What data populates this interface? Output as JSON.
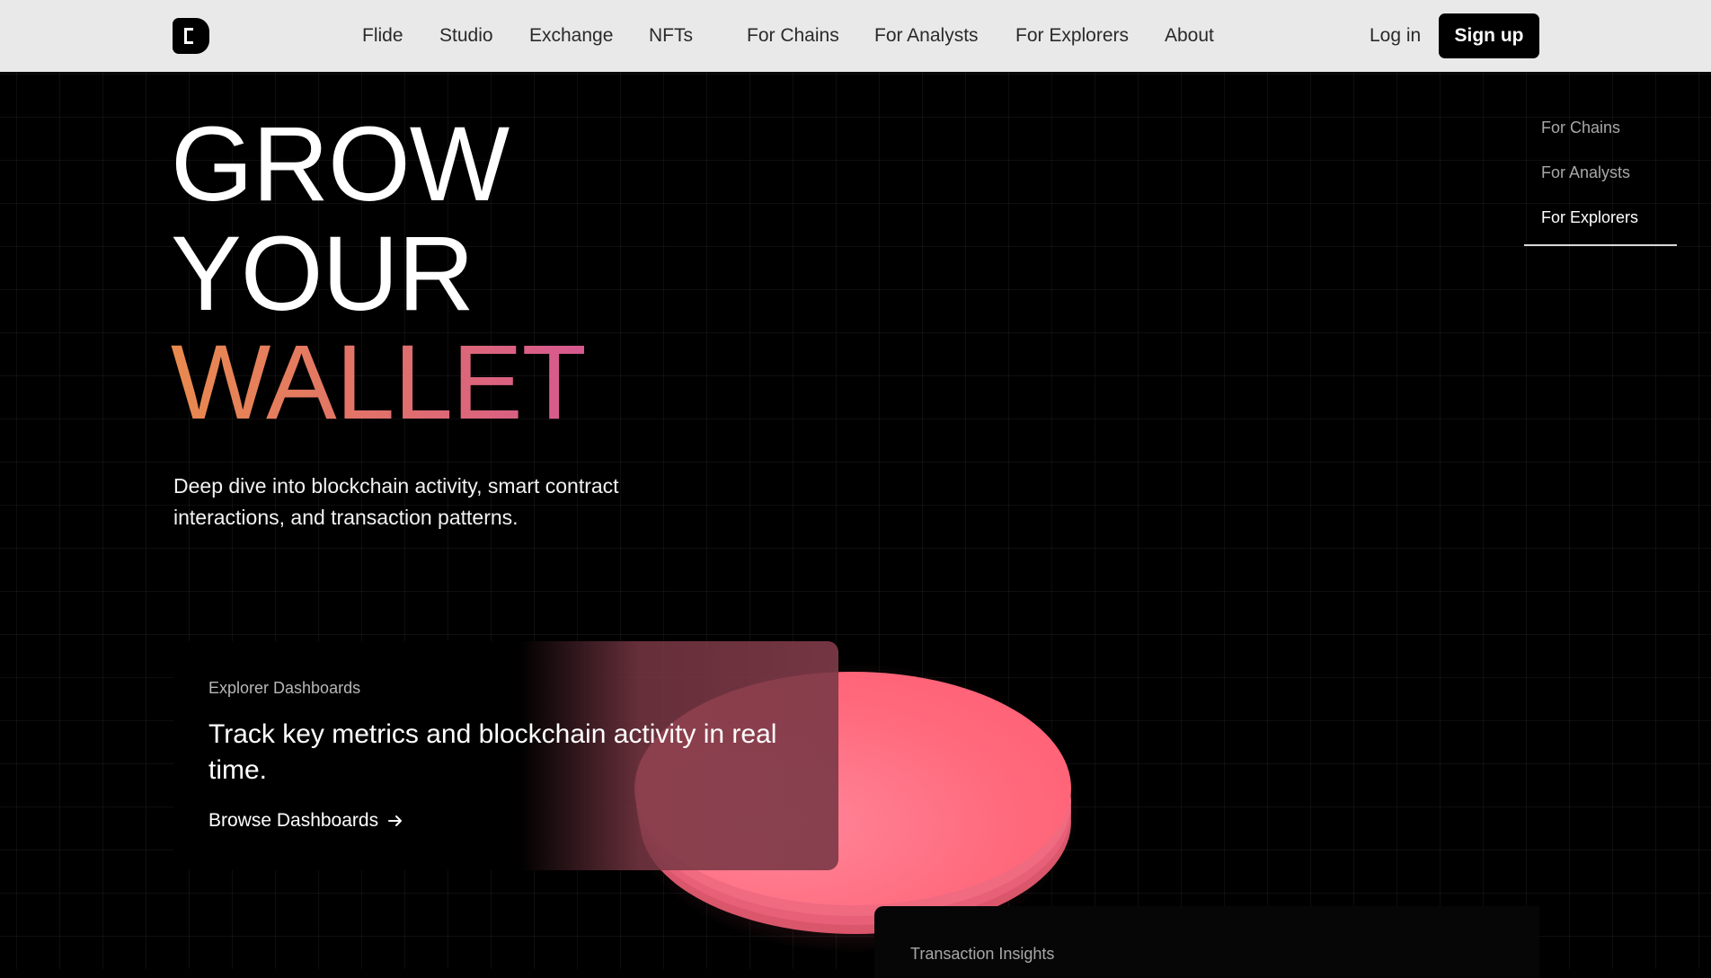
{
  "nav": {
    "links": [
      "Flide",
      "Studio",
      "Exchange",
      "NFTs",
      "For Chains",
      "For Analysts",
      "For Explorers",
      "About"
    ],
    "login": "Log in",
    "signup": "Sign up"
  },
  "hero": {
    "line1": "GROW",
    "line2": "YOUR",
    "line3": "WALLET",
    "subtitle": "Deep dive into blockchain activity, smart contract interactions, and transaction patterns."
  },
  "side_nav": {
    "items": [
      "For Chains",
      "For Analysts",
      "For Explorers"
    ],
    "active": "For Explorers"
  },
  "card_explorer": {
    "title": "Explorer Dashboards",
    "heading": "Track key metrics and blockchain activity in real time.",
    "link": "Browse Dashboards",
    "link_icon": "arrow-right-icon"
  },
  "card_transactions": {
    "title": "Transaction Insights"
  },
  "colors": {
    "nav_bg": "#e9e9e9",
    "accent_orange": "#e98a4e",
    "accent_pink": "#d6588f",
    "disc": "#ff6a7d"
  }
}
